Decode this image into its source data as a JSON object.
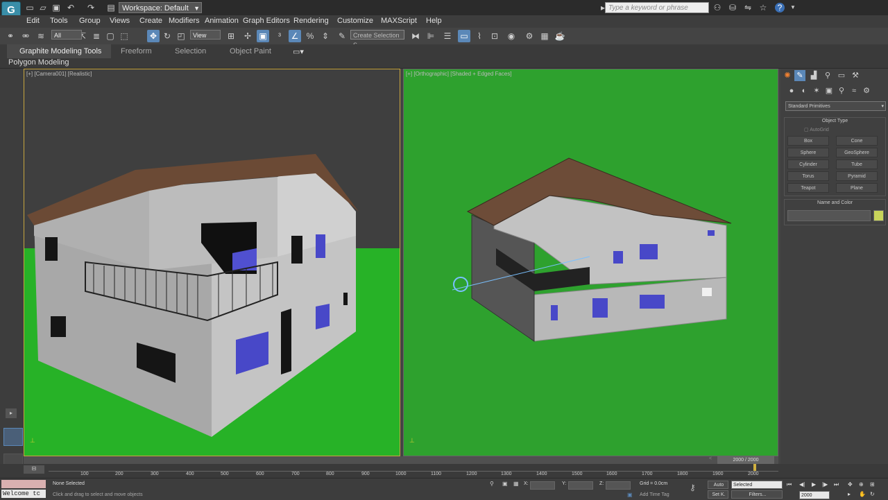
{
  "app": {
    "logo": "G"
  },
  "titlebar": {
    "workspace": "Workspace: Default",
    "search_placeholder": "Type a keyword or phrase",
    "icons": [
      "new-file-icon",
      "open-file-icon",
      "save-icon",
      "undo-icon",
      "redo-icon",
      "project-icon",
      "help-icon"
    ]
  },
  "menu": [
    "Edit",
    "Tools",
    "Group",
    "Views",
    "Create",
    "Modifiers",
    "Animation",
    "Graph Editors",
    "Rendering",
    "Customize",
    "MAXScript",
    "Help"
  ],
  "toolbar": {
    "filter_select": "All",
    "view_select": "View",
    "named_selection": "Create Selection S..."
  },
  "ribbon": {
    "tabs": [
      "Graphite Modeling Tools",
      "Freeform",
      "Selection",
      "Object Paint"
    ],
    "active_tab": "Graphite Modeling Tools",
    "subtitle": "Polygon Modeling"
  },
  "viewports": {
    "left_label": "[+] [Camera001] [Realistic]",
    "right_label": "[+] [Orthographic] [Shaded + Edged Faces]"
  },
  "command_panel": {
    "dropdown": "Standard Primitives",
    "object_type_title": "Object Type",
    "autogrid": "AutoGrid",
    "buttons": [
      "Box",
      "Cone",
      "Sphere",
      "GeoSphere",
      "Cylinder",
      "Tube",
      "Torus",
      "Pyramid",
      "Teapot",
      "Plane"
    ],
    "name_color_title": "Name and Color",
    "object_color": "#c8d45a"
  },
  "timeline": {
    "slider_label": "2000 / 2000",
    "ticks": [
      "100",
      "200",
      "300",
      "400",
      "500",
      "600",
      "700",
      "800",
      "900",
      "1000",
      "1100",
      "1200",
      "1300",
      "1400",
      "1500",
      "1600",
      "1700",
      "1800",
      "1900",
      "2000"
    ]
  },
  "status": {
    "maxscript": "Welcome tc",
    "selection": "None Selected",
    "prompt": "Click and drag to select and move objects",
    "x_label": "X:",
    "y_label": "Y:",
    "z_label": "Z:",
    "grid": "Grid = 0.0cm",
    "add_time_tag": "Add Time Tag",
    "auto_key": "Auto",
    "set_key": "Set K.",
    "key_filter": "Selected",
    "filters": "Filters...",
    "frame": "2000"
  }
}
